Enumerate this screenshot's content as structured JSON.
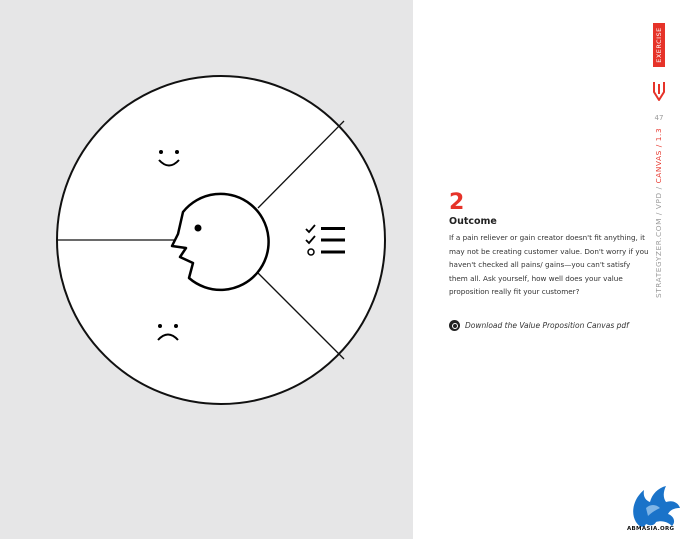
{
  "tab": {
    "label": "EXERCISE"
  },
  "page": {
    "number": "47"
  },
  "breadcrumb": {
    "prefix": "STRATEGYZER.COM / VPD / ",
    "section": "CANVAS / 1.3"
  },
  "step": {
    "number": "2",
    "title": "Outcome",
    "body": "If a pain reliever or gain creator doesn't fit anything, it may not be creating customer value. Don't worry if you haven't checked all pains/ gains—you can't satisfy them all. Ask yourself, how well does your value proposition really fit your customer?"
  },
  "download": {
    "label": "Download the Value Proposition Canvas pdf"
  },
  "logo": {
    "text": "ABMASIA.ORG"
  },
  "colors": {
    "accent": "#e63329",
    "panel": "#e6e6e7",
    "ink": "#111111"
  },
  "icons": {
    "gains": "smile-face-icon",
    "pains": "frown-face-icon",
    "jobs": "checklist-icon",
    "customer": "customer-profile-icon"
  }
}
